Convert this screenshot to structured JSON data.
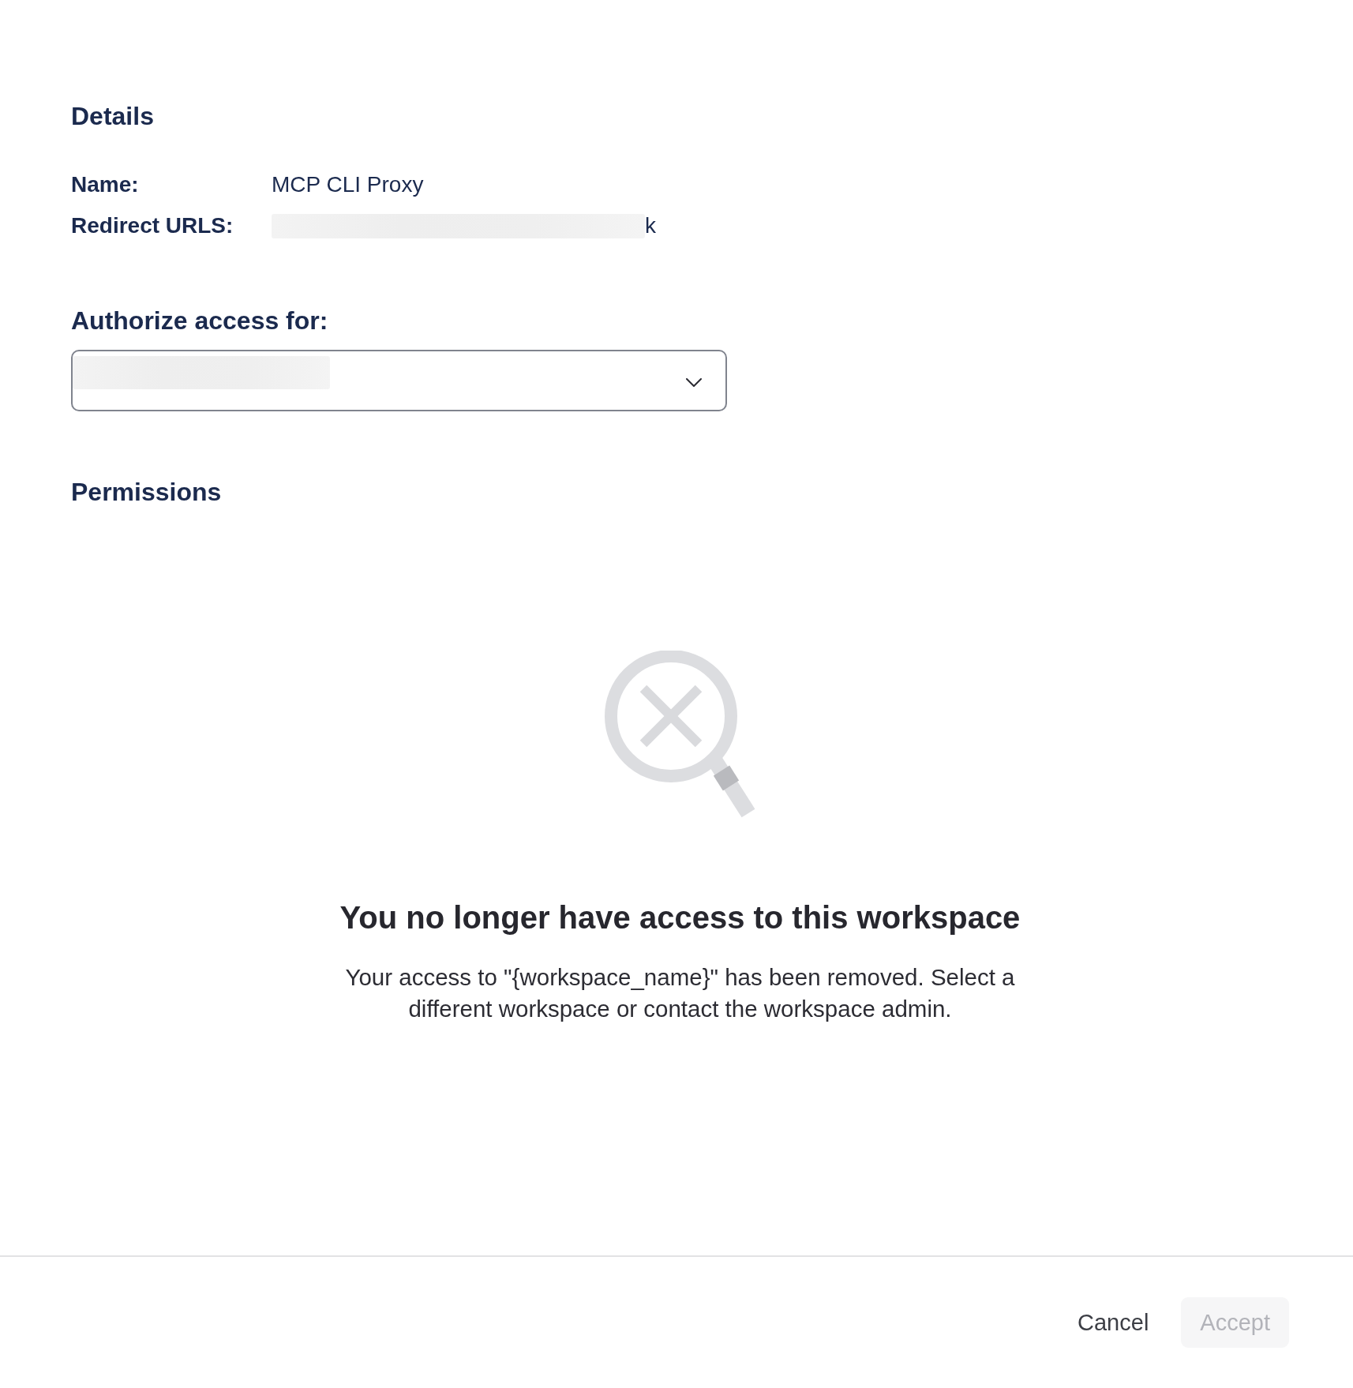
{
  "details": {
    "title": "Details",
    "fields": [
      {
        "label": "Name:",
        "value": "MCP CLI Proxy",
        "redacted": false
      },
      {
        "label": "Redirect URLS:",
        "value": "k",
        "redacted": true
      }
    ]
  },
  "workspace_select": {
    "label": "Authorize access for:",
    "redacted": true
  },
  "permissions": {
    "title": "Permissions",
    "empty_state": {
      "title": "You no longer have access to this workspace",
      "message": "Your access to \"{workspace_name}\" has been removed. Select a different workspace or contact the workspace admin."
    }
  },
  "footer": {
    "buttons": [
      {
        "label": "Cancel",
        "kind": "text",
        "disabled": false
      },
      {
        "label": "Accept",
        "kind": "filled",
        "disabled": true
      }
    ]
  }
}
